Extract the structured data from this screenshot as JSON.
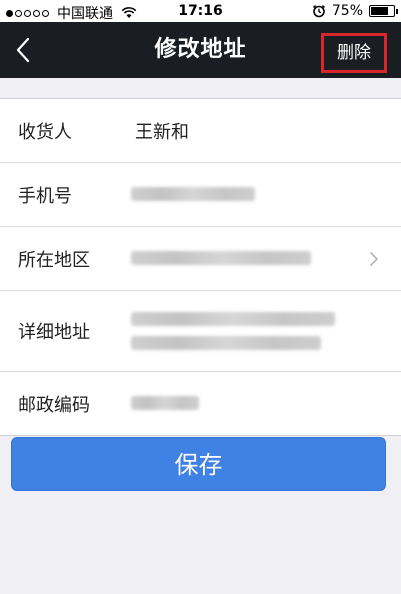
{
  "status_bar": {
    "carrier": "中国联通",
    "time": "17:16",
    "battery": "75%",
    "battery_level": 0.75,
    "icons": [
      "signal-dots",
      "wifi-icon",
      "alarm-icon",
      "battery-icon"
    ]
  },
  "nav": {
    "title": "修改地址",
    "delete_label": "删除",
    "back_icon": "chevron-left-icon",
    "highlight_color": "#d8262a"
  },
  "form": {
    "fields": [
      {
        "label": "收货人",
        "value": "王新和"
      },
      {
        "label": "手机号",
        "value": ""
      },
      {
        "label": "所在地区",
        "value": ""
      },
      {
        "label": "详细地址",
        "value": ""
      },
      {
        "label": "邮政编码",
        "value": ""
      }
    ]
  },
  "save_label": "保存",
  "colors": {
    "nav_bg": "#1a1d22",
    "page_bg": "#efeff4",
    "button_bg": "#3f82e3"
  }
}
